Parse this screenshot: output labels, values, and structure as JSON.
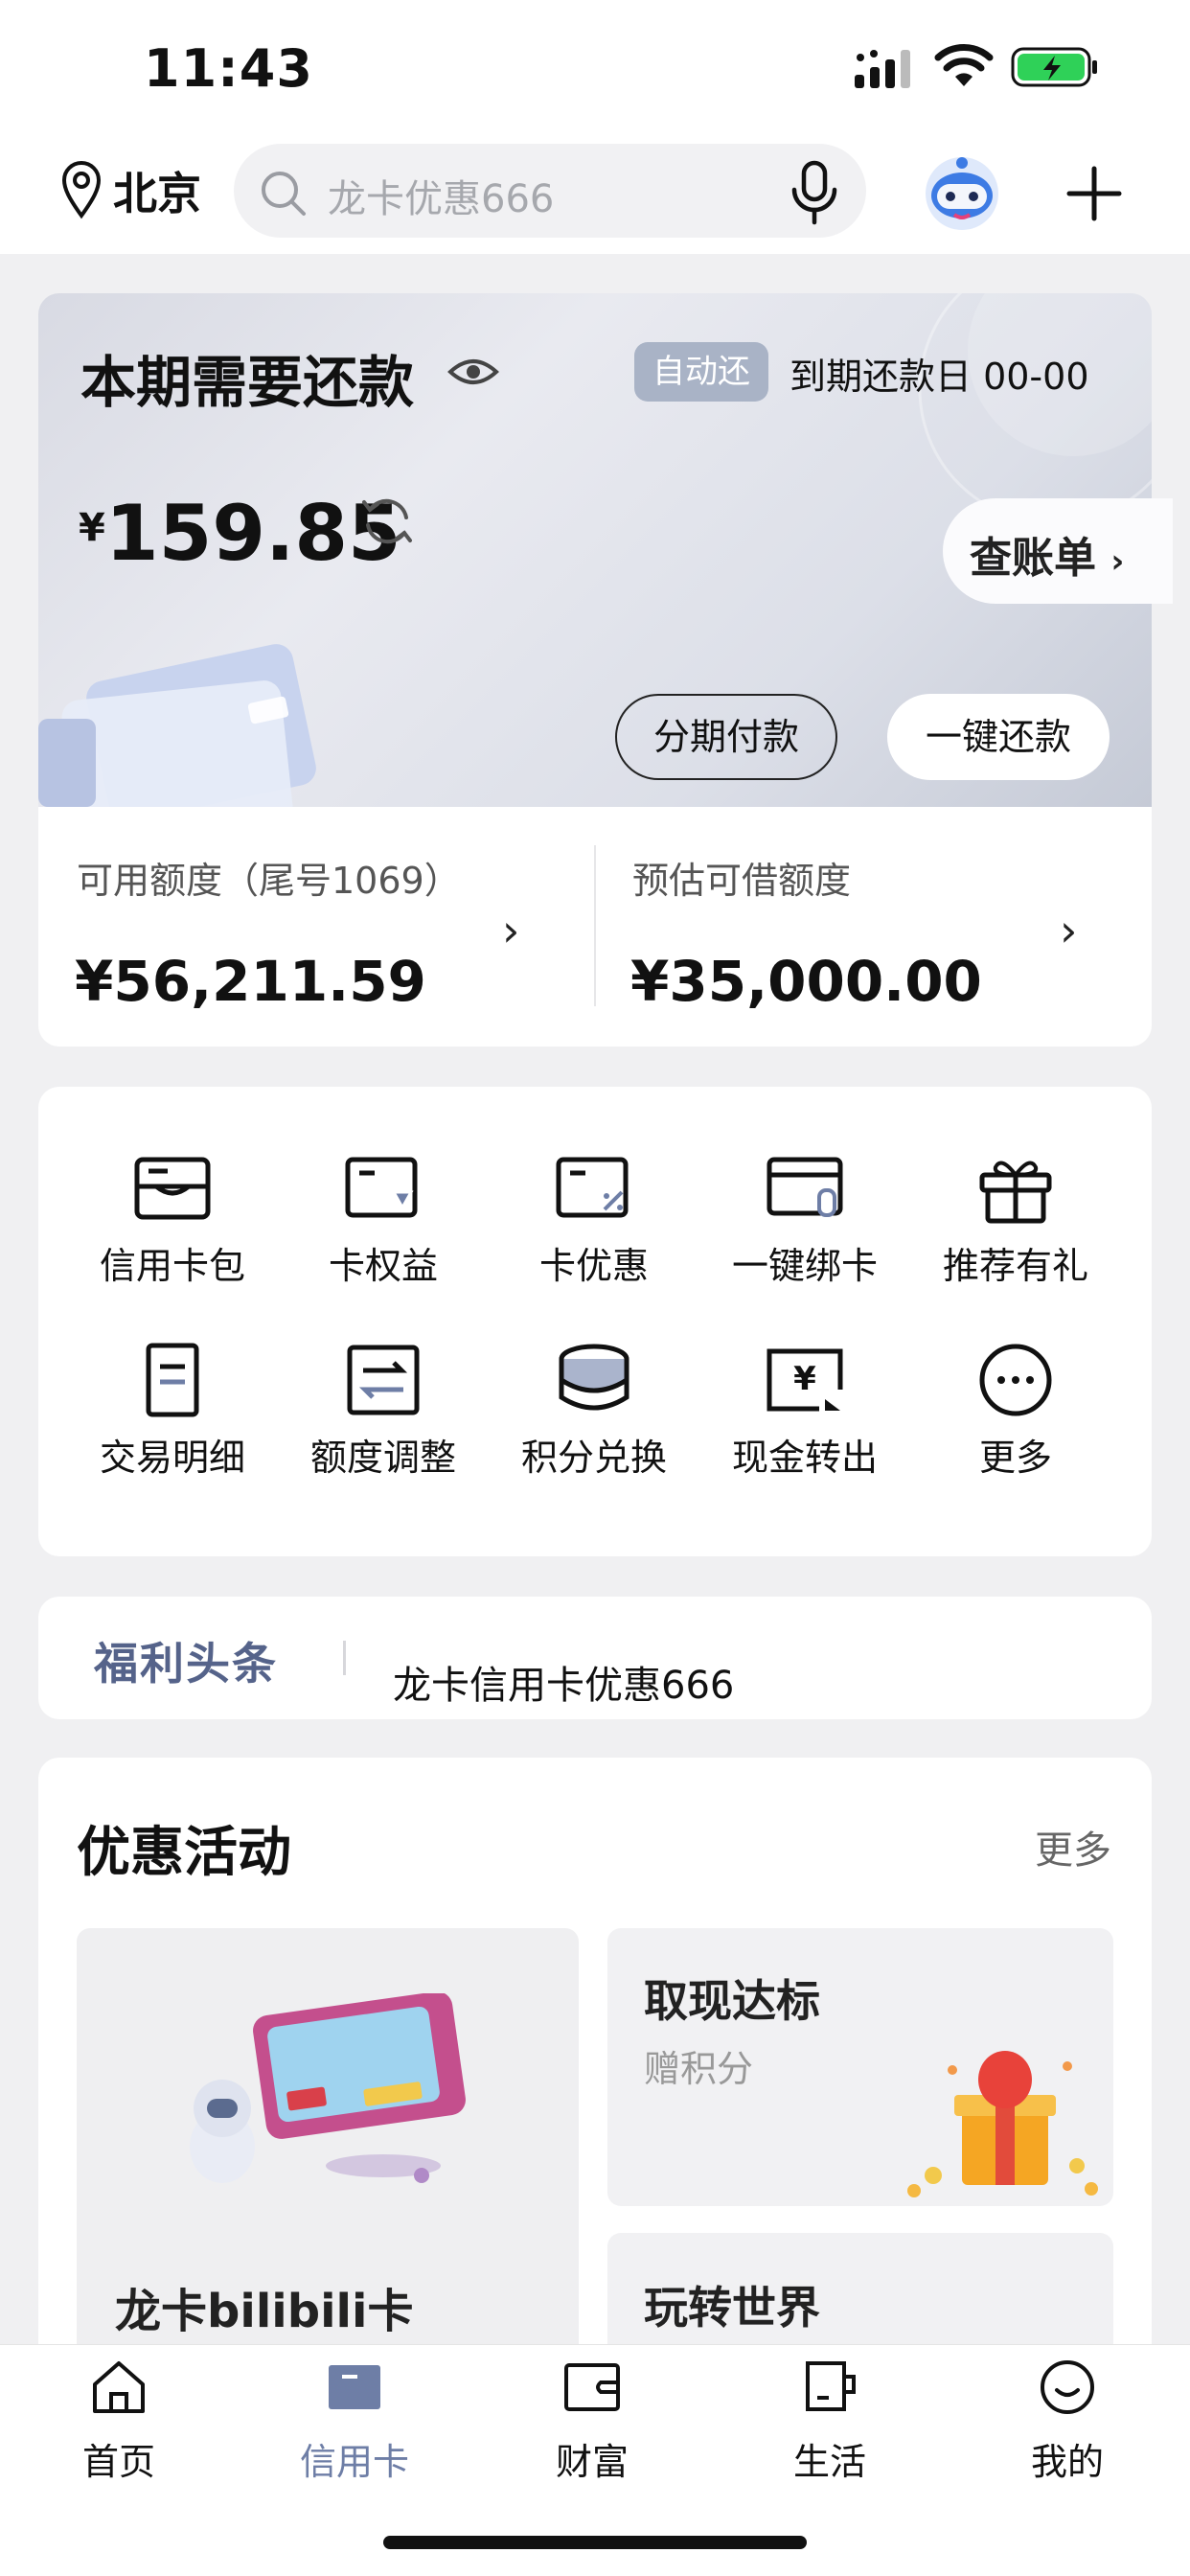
{
  "status_bar": {
    "time": "11:43"
  },
  "top_nav": {
    "city": "北京",
    "search_placeholder": "龙卡优惠666"
  },
  "repayment": {
    "title": "本期需要还款",
    "auto_badge": "自动还",
    "due_label": "到期还款日 00-00",
    "currency": "¥",
    "amount": "159.85",
    "bill_button": "查账单",
    "installment_button": "分期付款",
    "one_click_button": "一键还款"
  },
  "limits": {
    "available_label": "可用额度（尾号1069）",
    "available_value": "¥56,211.59",
    "borrow_label": "预估可借额度",
    "borrow_value": "¥35,000.00"
  },
  "services": [
    {
      "label": "信用卡包",
      "icon": "card-wallet-icon"
    },
    {
      "label": "卡权益",
      "icon": "card-benefit-icon"
    },
    {
      "label": "卡优惠",
      "icon": "card-discount-icon"
    },
    {
      "label": "一键绑卡",
      "icon": "bind-card-icon"
    },
    {
      "label": "推荐有礼",
      "icon": "gift-icon"
    },
    {
      "label": "交易明细",
      "icon": "transaction-icon"
    },
    {
      "label": "额度调整",
      "icon": "limit-adjust-icon"
    },
    {
      "label": "积分兑换",
      "icon": "points-icon"
    },
    {
      "label": "现金转出",
      "icon": "cash-out-icon"
    },
    {
      "label": "更多",
      "icon": "more-icon"
    }
  ],
  "welfare": {
    "logo": "福利头条",
    "headline": "龙卡信用卡优惠666"
  },
  "promotions": {
    "title": "优惠活动",
    "more": "更多",
    "big_card": {
      "label": "龙卡bilibili卡"
    },
    "small_cards": [
      {
        "title": "取现达标",
        "subtitle": "赠积分"
      },
      {
        "title": "玩转世界"
      }
    ]
  },
  "tabs": [
    {
      "label": "首页",
      "icon": "home-icon",
      "active": false
    },
    {
      "label": "信用卡",
      "icon": "credit-card-icon",
      "active": true
    },
    {
      "label": "财富",
      "icon": "wallet-icon",
      "active": false
    },
    {
      "label": "生活",
      "icon": "cup-icon",
      "active": false
    },
    {
      "label": "我的",
      "icon": "smile-icon",
      "active": false
    }
  ],
  "colors": {
    "active_tab": "#6e7ea6",
    "auto_badge": "#a9b3c6",
    "welfare_logo": "#55638a"
  }
}
